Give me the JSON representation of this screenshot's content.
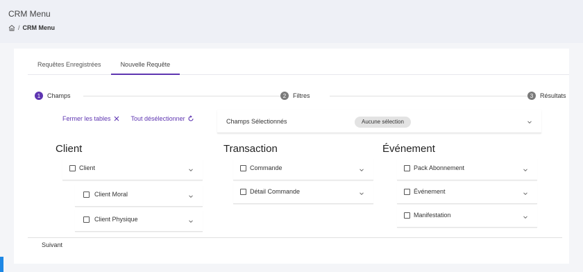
{
  "header": {
    "title": "CRM Menu",
    "breadcrumb": {
      "separator": "/",
      "current": "CRM Menu"
    }
  },
  "tabs": [
    {
      "label": "Requêtes Enregistrées",
      "active": false
    },
    {
      "label": "Nouvelle Requête",
      "active": true
    }
  ],
  "stepper": [
    {
      "number": "1",
      "label": "Champs",
      "active": true
    },
    {
      "number": "2",
      "label": "Filtres",
      "active": false
    },
    {
      "number": "3",
      "label": "Résultats",
      "active": false
    }
  ],
  "actions": {
    "close_tables": "Fermer les tables",
    "deselect_all": "Tout désélectionner"
  },
  "selected_fields": {
    "label": "Champs Sélectionnés",
    "chip": "Aucune sélection"
  },
  "columns": [
    {
      "title": "Client",
      "items": [
        {
          "label": "Client",
          "level": 0
        },
        {
          "label": "Client Moral",
          "level": 1
        },
        {
          "label": "Client Physique",
          "level": 1
        }
      ]
    },
    {
      "title": "Transaction",
      "items": [
        {
          "label": "Commande",
          "level": 0
        },
        {
          "label": "Détail Commande",
          "level": 0
        }
      ]
    },
    {
      "title": "Événement",
      "items": [
        {
          "label": "Pack Abonnement",
          "level": 0
        },
        {
          "label": "Événement",
          "level": 0
        },
        {
          "label": "Manifestation",
          "level": 0
        }
      ]
    }
  ],
  "next_button": "Suivant",
  "colors": {
    "accent": "#5e35b1",
    "step_inactive": "#7a7a7a",
    "side_accent": "#1e88e5"
  }
}
